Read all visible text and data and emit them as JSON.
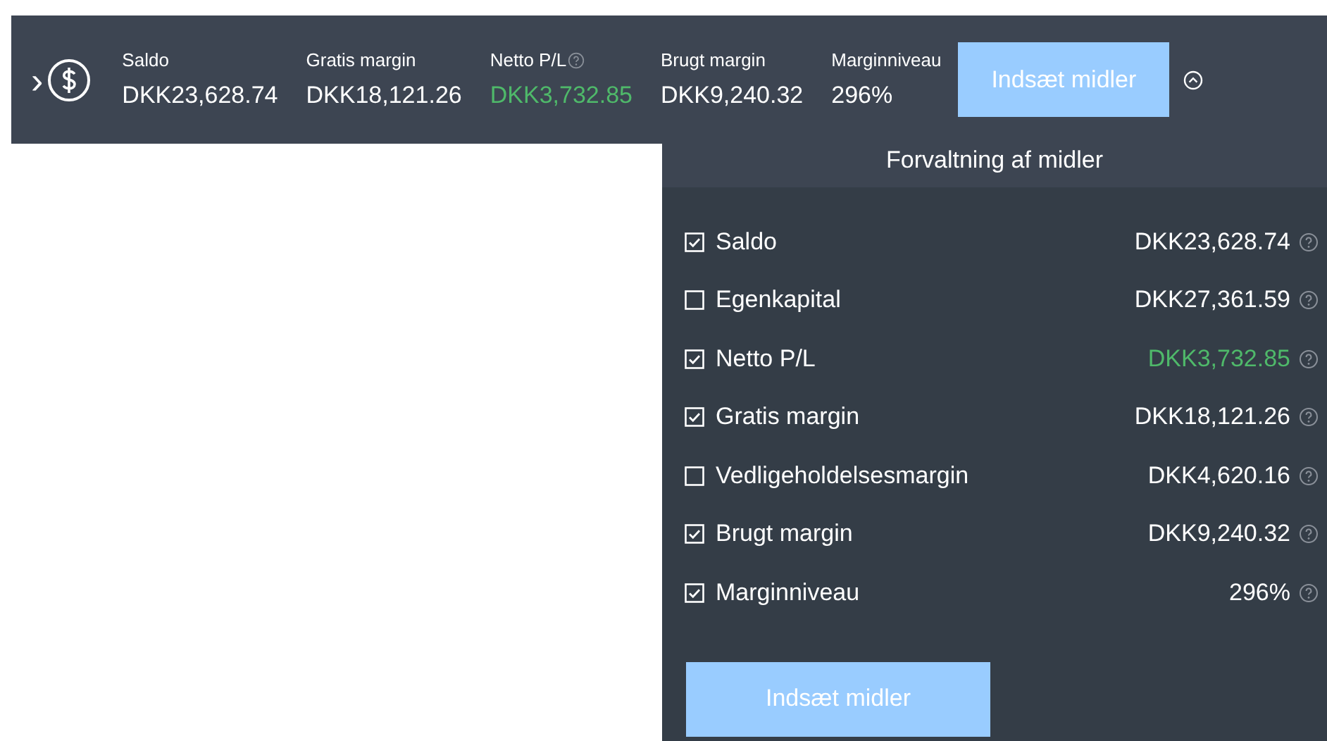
{
  "summary_bar": {
    "expand_glyph": "›",
    "items": [
      {
        "label": "Saldo",
        "value": "DKK23,628.74",
        "positive": false,
        "help": false
      },
      {
        "label": "Gratis margin",
        "value": "DKK18,121.26",
        "positive": false,
        "help": false
      },
      {
        "label": "Netto P/L",
        "value": "DKK3,732.85",
        "positive": true,
        "help": true
      },
      {
        "label": "Brugt margin",
        "value": "DKK9,240.32",
        "positive": false,
        "help": false
      },
      {
        "label": "Marginniveau",
        "value": "296%",
        "positive": false,
        "help": false
      }
    ],
    "button": "Indsæt midler"
  },
  "funds_panel": {
    "title": "Forvaltning af midler",
    "rows": [
      {
        "label": "Saldo",
        "value": "DKK23,628.74",
        "checked": true,
        "positive": false
      },
      {
        "label": "Egenkapital",
        "value": "DKK27,361.59",
        "checked": false,
        "positive": false
      },
      {
        "label": "Netto P/L",
        "value": "DKK3,732.85",
        "checked": true,
        "positive": true
      },
      {
        "label": "Gratis margin",
        "value": "DKK18,121.26",
        "checked": true,
        "positive": false
      },
      {
        "label": "Vedligeholdelsesmargin",
        "value": "DKK4,620.16",
        "checked": false,
        "positive": false
      },
      {
        "label": "Brugt margin",
        "value": "DKK9,240.32",
        "checked": true,
        "positive": false
      },
      {
        "label": "Marginniveau",
        "value": "296%",
        "checked": true,
        "positive": false
      }
    ],
    "button": "Indsæt midler"
  }
}
